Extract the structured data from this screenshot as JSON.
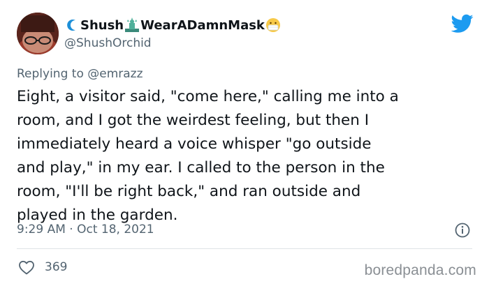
{
  "tweet": {
    "author": {
      "display_name_part1": "Shush",
      "display_name_part2": "WearADamnMask",
      "handle": "@ShushOrchid",
      "name_icons": [
        "moon-icon",
        "statue-of-liberty-icon",
        "face-mask-emoji-icon"
      ]
    },
    "reply": {
      "prefix": "Replying to",
      "handle": "@emrazz"
    },
    "text_lines": [
      "Eight, a visitor said, \"come here,\" calling me into a",
      "room, and I got the weirdest feeling, but then I",
      "immediately heard a voice whisper \"go outside",
      "and play,\" in my ear. I called to the person in the",
      "room, \"I'll be right back,\" and ran outside and",
      "played in the garden."
    ],
    "timestamp": "9:29 AM · Oct 18, 2021",
    "likes": "369"
  },
  "watermark": "boredpanda.com",
  "colors": {
    "twitter_blue": "#1d9bf0",
    "secondary_text": "#536471",
    "primary_text": "#0f1419"
  }
}
